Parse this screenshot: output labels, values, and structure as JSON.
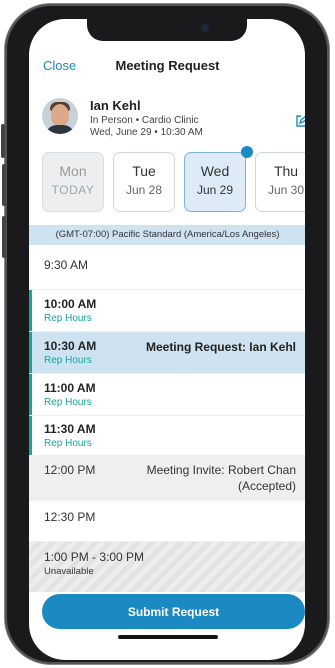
{
  "navbar": {
    "close_label": "Close",
    "title": "Meeting Request"
  },
  "contact": {
    "name": "Ian Kehl",
    "line1": "In Person • Cardio Clinic",
    "line2": "Wed, June 29 • 10:30 AM"
  },
  "days": [
    {
      "name": "Mon",
      "date": "TODAY",
      "state": "today"
    },
    {
      "name": "Tue",
      "date": "Jun 28",
      "state": "normal"
    },
    {
      "name": "Wed",
      "date": "Jun 29",
      "state": "selected"
    },
    {
      "name": "Thu",
      "date": "Jun 30",
      "state": "normal"
    }
  ],
  "timezone": "(GMT-07:00) Pacific Standard (America/Los Angeles)",
  "slots": {
    "s930": {
      "time": "9:30 AM"
    },
    "s1000": {
      "time": "10:00 AM",
      "sub": "Rep Hours"
    },
    "s1030": {
      "time": "10:30 AM",
      "sub": "Rep Hours",
      "event": "Meeting Request: Ian Kehl"
    },
    "s1100": {
      "time": "11:00 AM",
      "sub": "Rep Hours"
    },
    "s1130": {
      "time": "11:30 AM",
      "sub": "Rep Hours"
    },
    "s1200": {
      "time": "12:00 PM",
      "event_line1": "Meeting Invite: Robert Chan",
      "event_line2": "(Accepted)"
    },
    "s1230": {
      "time": "12:30 PM"
    },
    "s1300": {
      "time": "1:00 PM - 3:00 PM",
      "sub": "Unavailable"
    }
  },
  "submit_label": "Submit Request",
  "colors": {
    "accent": "#1c8ac2",
    "rep_hours": "#17a5a0",
    "highlight": "#cfe2f0"
  },
  "icons": {
    "edit": "edit-icon"
  }
}
